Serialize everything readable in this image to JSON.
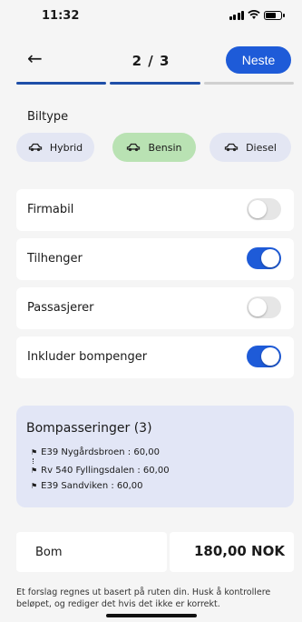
{
  "status": {
    "time": "11:32"
  },
  "nav": {
    "back_icon": "arrow-left-icon",
    "step": "2 / 3",
    "next_label": "Neste",
    "accent": "#1e5bd8"
  },
  "progress": {
    "steps_total": 3,
    "steps_done": 2
  },
  "car_type": {
    "label": "Biltype",
    "options": [
      {
        "label": "Hybrid",
        "icon": "car-icon",
        "selected": false
      },
      {
        "label": "Bensin",
        "icon": "car-icon",
        "selected": true
      },
      {
        "label": "Diesel",
        "icon": "car-icon",
        "selected": false
      }
    ]
  },
  "toggles": [
    {
      "label": "Firmabil",
      "on": false
    },
    {
      "label": "Tilhenger",
      "on": true
    },
    {
      "label": "Passasjerer",
      "on": false
    },
    {
      "label": "Inkluder bompenger",
      "on": true
    }
  ],
  "tolls": {
    "title": "Bompasseringer (3)",
    "items": [
      "E39 Nygårdsbroen : 60,00",
      "Rv 540 Fyllingsdalen : 60,00",
      "E39 Sandviken : 60,00"
    ]
  },
  "total": {
    "label": "Bom",
    "amount": "180,00 NOK"
  },
  "footnote": "Et forslag regnes ut basert på ruten din. Husk å kontrollere beløpet, og rediger det hvis det ikke er korrekt."
}
